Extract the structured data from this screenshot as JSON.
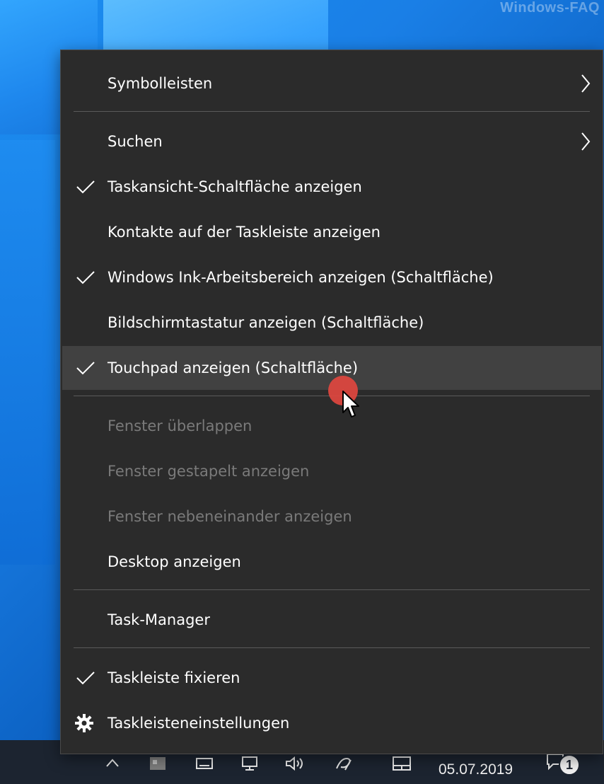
{
  "desktop": {
    "watermark": "Windows-FAQ"
  },
  "menu": {
    "items": [
      {
        "label": "Symbolleisten",
        "submenu": true
      },
      {
        "label": "Suchen",
        "submenu": true
      },
      {
        "label": "Taskansicht-Schaltfläche anzeigen",
        "checked": true
      },
      {
        "label": "Kontakte auf der Taskleiste anzeigen"
      },
      {
        "label": "Windows Ink-Arbeitsbereich anzeigen (Schaltfläche)",
        "checked": true
      },
      {
        "label": "Bildschirmtastatur anzeigen (Schaltfläche)"
      },
      {
        "label": "Touchpad anzeigen (Schaltfläche)",
        "checked": true,
        "hover": true
      },
      {
        "label": "Fenster überlappen",
        "disabled": true
      },
      {
        "label": "Fenster gestapelt anzeigen",
        "disabled": true
      },
      {
        "label": "Fenster nebeneinander anzeigen",
        "disabled": true
      },
      {
        "label": "Desktop anzeigen"
      },
      {
        "label": "Task-Manager"
      },
      {
        "label": "Taskleiste fixieren",
        "checked": true
      },
      {
        "label": "Taskleisteneinstellungen",
        "icon": "gear-icon"
      }
    ]
  },
  "taskbar": {
    "date": "05.07.2019",
    "notification_count": "1"
  },
  "colors": {
    "menu_bg": "#2b2b2b",
    "hover_bg": "#414141",
    "text": "#ffffff",
    "disabled_text": "#7a7a7a",
    "click_indicator": "#e0473f"
  }
}
